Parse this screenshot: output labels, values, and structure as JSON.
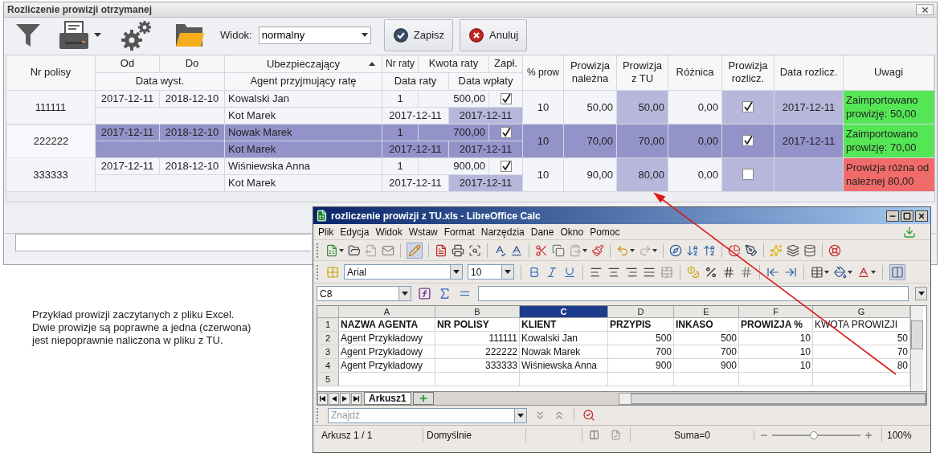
{
  "main_window": {
    "title": "Rozliczenie prowizji otrzymanej",
    "toolbar": {
      "view_label": "Widok:",
      "view_value": "normalny",
      "buttons": [
        {
          "label": "Zapisz",
          "kind": "save"
        },
        {
          "label": "Anuluj",
          "kind": "cancel"
        }
      ]
    },
    "table": {
      "sort_ascending": true,
      "columns": {
        "nr_polisy": "Nr polisy",
        "od": "Od",
        "do": "Do",
        "ubezpieczajacy": "Ubezpieczający",
        "nr_raty": "Nr raty",
        "kwota_raty": "Kwota raty",
        "zaplacona": "Zapł.",
        "data_wyst": "Data wyst.",
        "agent": "Agent przyjmujący ratę",
        "data_raty": "Data raty",
        "data_wplaty": "Data wpłaty",
        "procent": "% prow",
        "prowizja_nalezna": "Prowizja należna",
        "prowizja_tu": "Prowizja z TU",
        "roznica": "Różnica",
        "prowizja_rozliczona": "Prowizja rozlicz.",
        "data_rozliczenia": "Data rozlicz.",
        "uwagi": "Uwagi"
      },
      "rows": [
        {
          "selected": false,
          "nr_polisy": "111111",
          "od": "2017-12-11",
          "do": "2018-12-10",
          "ubezpieczajacy": "Kowalski Jan",
          "nr_raty": "1",
          "kwota_raty": "500,00",
          "zaplacona": true,
          "agent": "Kot Marek",
          "data_raty": "2017-12-11",
          "data_wplaty": "2017-12-11",
          "procent": "10",
          "prowizja_nalezna": "50,00",
          "prowizja_tu": "50,00",
          "roznica": "0,00",
          "prowizja_rozliczona": true,
          "data_rozliczenia": "2017-12-11",
          "uwagi": {
            "text": "Zaimportowano prowizję: 50,00",
            "color": "#55e655"
          }
        },
        {
          "selected": true,
          "nr_polisy": "222222",
          "od": "2017-12-11",
          "do": "2018-12-10",
          "ubezpieczajacy": "Nowak Marek",
          "nr_raty": "1",
          "kwota_raty": "700,00",
          "zaplacona": true,
          "agent": "Kot Marek",
          "data_raty": "2017-12-11",
          "data_wplaty": "2017-12-11",
          "procent": "10",
          "prowizja_nalezna": "70,00",
          "prowizja_tu": "70,00",
          "roznica": "0,00",
          "prowizja_rozliczona": true,
          "data_rozliczenia": "2017-12-11",
          "uwagi": {
            "text": "Zaimportowano prowizję: 70,00",
            "color": "#55e655"
          }
        },
        {
          "selected": false,
          "nr_polisy": "333333",
          "od": "2017-12-11",
          "do": "2018-12-10",
          "ubezpieczajacy": "Wiśniewska Anna",
          "nr_raty": "1",
          "kwota_raty": "900,00",
          "zaplacona": true,
          "agent": "Kot Marek",
          "data_raty": "2017-12-11",
          "data_wplaty": "2017-12-11",
          "procent": "10",
          "prowizja_nalezna": "90,00",
          "prowizja_tu": "80,00",
          "roznica": "0,00",
          "prowizja_rozliczona": false,
          "uwagi": {
            "text": "Prowizja różna od należnej 80,00",
            "color": "#f26b6b"
          }
        }
      ]
    }
  },
  "note": "Przykład prowizji zaczytanych z pliku Excel.\nDwie prowizje są poprawne a jedna (czerwona)\njest niepoprawnie naliczona w pliku z TU.",
  "calc_window": {
    "title": "rozliczenie prowizji z TU.xls - LibreOffice Calc",
    "menu": [
      "Plik",
      "Edycja",
      "Widok",
      "Wstaw",
      "Format",
      "Narzędzia",
      "Dane",
      "Okno",
      "Pomoc"
    ],
    "font_name": "Arial",
    "font_size": "10",
    "name_box": "C8",
    "columns": [
      {
        "label": "A",
        "selected": false
      },
      {
        "label": "B",
        "selected": false
      },
      {
        "label": "C",
        "selected": true
      },
      {
        "label": "D",
        "selected": false
      },
      {
        "label": "E",
        "selected": false
      },
      {
        "label": "F",
        "selected": false
      },
      {
        "label": "G",
        "selected": false
      }
    ],
    "header_row": {
      "number": "1",
      "cells": [
        {
          "text": "NAZWA AGENTA",
          "bold": true
        },
        {
          "text": "NR POLISY",
          "bold": true
        },
        {
          "text": "KLIENT",
          "bold": true
        },
        {
          "text": "PRZYPIS",
          "bold": true
        },
        {
          "text": "INKASO",
          "bold": true
        },
        {
          "text": "PROWIZJA %",
          "bold": true
        },
        {
          "text": "KWOTA PROWIZJI",
          "bold": false
        }
      ]
    },
    "rows": [
      {
        "number": "2",
        "cells": [
          "Agent Przykładowy",
          "111111",
          "Kowalski Jan",
          "500",
          "500",
          "10",
          "50"
        ]
      },
      {
        "number": "3",
        "cells": [
          "Agent Przykładowy",
          "222222",
          "Nowak Marek",
          "700",
          "700",
          "10",
          "70"
        ]
      },
      {
        "number": "4",
        "cells": [
          "Agent Przykładowy",
          "333333",
          "Wiśniewska Anna",
          "900",
          "900",
          "10",
          "80"
        ]
      },
      {
        "number": "5",
        "cells": []
      }
    ],
    "sheet_tabs": [
      {
        "label": "Arkusz1",
        "selected": true
      }
    ],
    "find_placeholder": "Znajdź",
    "status": {
      "sheet": "Arkusz 1 / 1",
      "style": "Domyślnie",
      "sum": "Suma=0",
      "zoom_slider": {
        "level": 0.47
      },
      "zoom": "100%"
    }
  }
}
